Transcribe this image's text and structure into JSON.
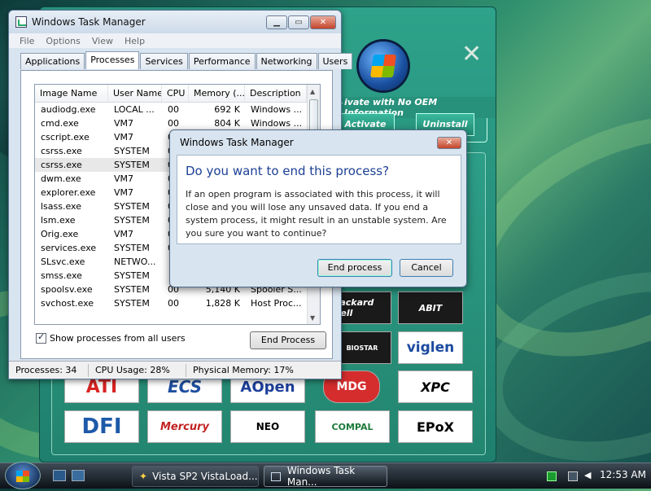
{
  "app_window": {
    "group_label": "ivate with No OEM Information",
    "activate_label": "Activate",
    "uninstall_label": "Uninstall",
    "brand_tiles": [
      "ATI",
      "ECS",
      "AOpen",
      "MDG",
      "XPC",
      "DFI",
      "Mercury",
      "NEO",
      "COMPAL",
      "EPoX",
      "Packard Bell",
      "ABIT",
      "BIOSTAR",
      "viglen"
    ]
  },
  "task_manager": {
    "title": "Windows Task Manager",
    "menu": [
      "File",
      "Options",
      "View",
      "Help"
    ],
    "tabs": [
      "Applications",
      "Processes",
      "Services",
      "Performance",
      "Networking",
      "Users"
    ],
    "active_tab": "Processes",
    "columns": [
      "Image Name",
      "User Name",
      "CPU",
      "Memory (...",
      "Description"
    ],
    "rows": [
      {
        "name": "audiodg.exe",
        "user": "LOCAL ...",
        "cpu": "00",
        "mem": "692 K",
        "desc": "Windows ..."
      },
      {
        "name": "cmd.exe",
        "user": "VM7",
        "cpu": "00",
        "mem": "804 K",
        "desc": "Windows ..."
      },
      {
        "name": "cscript.exe",
        "user": "VM7",
        "cpu": "00",
        "mem": "",
        "desc": ""
      },
      {
        "name": "csrss.exe",
        "user": "SYSTEM",
        "cpu": "00",
        "mem": "",
        "desc": ""
      },
      {
        "name": "csrss.exe",
        "user": "SYSTEM",
        "cpu": "00",
        "mem": "",
        "desc": ""
      },
      {
        "name": "dwm.exe",
        "user": "VM7",
        "cpu": "00",
        "mem": "",
        "desc": ""
      },
      {
        "name": "explorer.exe",
        "user": "VM7",
        "cpu": "00",
        "mem": "",
        "desc": ""
      },
      {
        "name": "lsass.exe",
        "user": "SYSTEM",
        "cpu": "00",
        "mem": "",
        "desc": ""
      },
      {
        "name": "lsm.exe",
        "user": "SYSTEM",
        "cpu": "00",
        "mem": "",
        "desc": ""
      },
      {
        "name": "Orig.exe",
        "user": "VM7",
        "cpu": "00",
        "mem": "",
        "desc": ""
      },
      {
        "name": "services.exe",
        "user": "SYSTEM",
        "cpu": "00",
        "mem": "",
        "desc": ""
      },
      {
        "name": "SLsvc.exe",
        "user": "NETWO...",
        "cpu": "",
        "mem": "",
        "desc": ""
      },
      {
        "name": "smss.exe",
        "user": "SYSTEM",
        "cpu": "",
        "mem": "",
        "desc": ""
      },
      {
        "name": "spoolsv.exe",
        "user": "SYSTEM",
        "cpu": "00",
        "mem": "5,140 K",
        "desc": "Spooler S..."
      },
      {
        "name": "svchost.exe",
        "user": "SYSTEM",
        "cpu": "00",
        "mem": "1,828 K",
        "desc": "Host Proc..."
      }
    ],
    "selected_row": 4,
    "show_all_label": "Show processes from all users",
    "end_process_label": "End Process",
    "status": {
      "processes": "Processes: 34",
      "cpu": "CPU Usage: 28%",
      "memory": "Physical Memory: 17%"
    }
  },
  "dialog": {
    "title": "Windows Task Manager",
    "question": "Do you want to end this process?",
    "message": "If an open program is associated with this process, it will close and you will lose any unsaved data. If you end a system process, it might result in an unstable system. Are you sure you want to continue?",
    "end_label": "End process",
    "cancel_label": "Cancel"
  },
  "taskbar": {
    "buttons": [
      "Vista SP2 VistaLoad...",
      "Windows Task Man..."
    ],
    "active_button": 1,
    "clock": "12:53 AM"
  }
}
